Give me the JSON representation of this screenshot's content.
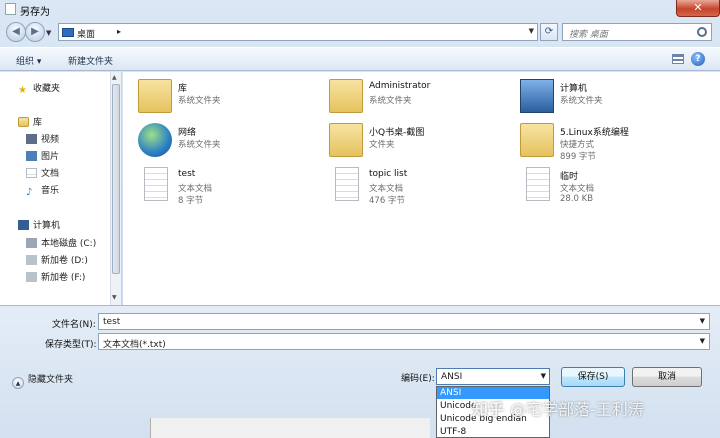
{
  "window": {
    "title": "另存为",
    "close_glyph": "✕"
  },
  "address": {
    "crumb": "桌面",
    "arrow": "▸",
    "search_placeholder": "搜索 桌面"
  },
  "toolbar": {
    "organize": "组织 ▾",
    "new_folder": "新建文件夹",
    "help": "?"
  },
  "nav": {
    "favorites": "收藏夹",
    "libraries": "库",
    "lib_items": [
      "视频",
      "图片",
      "文档",
      "音乐"
    ],
    "computer": "计算机",
    "drives": [
      "本地磁盘 (C:)",
      "新加卷 (D:)",
      "新加卷 (F:)"
    ]
  },
  "items": [
    {
      "name": "库",
      "l2": "系统文件夹",
      "l3": "",
      "icon": "library-icon"
    },
    {
      "name": "Administrator",
      "l2": "系统文件夹",
      "l3": "",
      "icon": "user-folder-icon"
    },
    {
      "name": "计算机",
      "l2": "系统文件夹",
      "l3": "",
      "icon": "computer-icon"
    },
    {
      "name": "网络",
      "l2": "系统文件夹",
      "l3": "",
      "icon": "network-icon"
    },
    {
      "name": "小Q书桌-截图",
      "l2": "文件夹",
      "l3": "",
      "icon": "folder-icon"
    },
    {
      "name": "5.Linux系统编程",
      "l2": "快捷方式",
      "l3": "899 字节",
      "icon": "shortcut-folder-icon"
    },
    {
      "name": "test",
      "l2": "文本文档",
      "l3": "8 字节",
      "icon": "text-document-icon"
    },
    {
      "name": "topic list",
      "l2": "文本文档",
      "l3": "476 字节",
      "icon": "text-document-icon"
    },
    {
      "name": "临时",
      "l2": "文本文档",
      "l3": "28.0 KB",
      "icon": "text-document-icon"
    }
  ],
  "form": {
    "filename_label": "文件名(N):",
    "filename_value": "test",
    "filetype_label": "保存类型(T):",
    "filetype_value": "文本文档(*.txt)",
    "hide_folders": "隐藏文件夹",
    "encoding_label": "编码(E):",
    "encoding_value": "ANSI",
    "encoding_options": [
      "ANSI",
      "Unicode",
      "Unicode big endian",
      "UTF-8"
    ],
    "save": "保存(S)",
    "cancel": "取消"
  },
  "watermark": {
    "site": "知乎",
    "handle": "@宅学部落-王利涛"
  },
  "colors": {
    "selection": "#3399ff",
    "folder": "#e6c35f",
    "close": "#c7432c"
  }
}
